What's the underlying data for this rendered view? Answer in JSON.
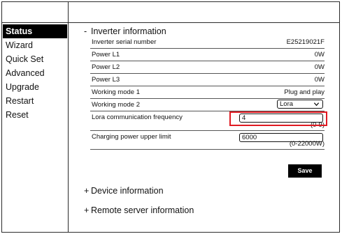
{
  "nav": {
    "items": [
      {
        "label": "Status",
        "active": true
      },
      {
        "label": "Wizard",
        "active": false
      },
      {
        "label": "Quick Set",
        "active": false
      },
      {
        "label": "Advanced",
        "active": false
      },
      {
        "label": "Upgrade",
        "active": false
      },
      {
        "label": "Restart",
        "active": false
      },
      {
        "label": "Reset",
        "active": false
      }
    ]
  },
  "inverter": {
    "toggle": "-",
    "title": "Inverter information",
    "rows": [
      {
        "label": "Inverter serial number",
        "value": "E25219021F"
      },
      {
        "label": "Power L1",
        "value": "0W"
      },
      {
        "label": "Power L2",
        "value": "0W"
      },
      {
        "label": "Power L3",
        "value": "0W"
      },
      {
        "label": "Working mode 1",
        "value": "Plug and play"
      }
    ],
    "working_mode_2": {
      "label": "Working mode 2",
      "selected": "Lora"
    },
    "lora_frequency": {
      "label": "Lora communication frequency",
      "value": "4",
      "range": "(0-9)"
    },
    "charging_limit": {
      "label": "Charging power upper limit",
      "value": "6000",
      "range": "(0-22000W)"
    },
    "save_label": "Save"
  },
  "device": {
    "toggle": "+",
    "title": "Device information"
  },
  "remote": {
    "toggle": "+",
    "title": "Remote server information"
  },
  "colors": {
    "highlight": "#e01a22",
    "active_nav_bg": "#000000"
  }
}
